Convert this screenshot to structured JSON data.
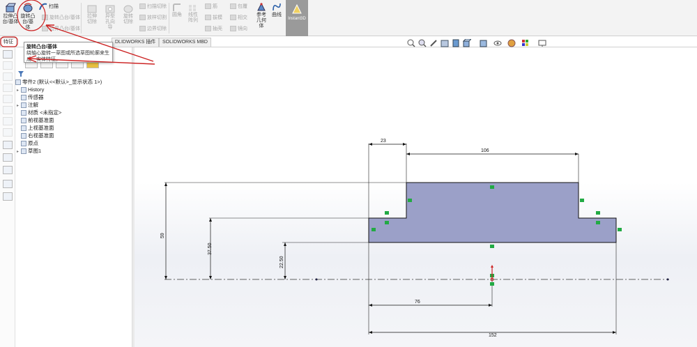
{
  "ribbon": {
    "extrude_boss": "拉伸凸台/基体",
    "revolve_boss": "旋转凸台/基体",
    "sweep": "扫描",
    "loft_disabled": "旋转凸台/基体",
    "boundary_boss": "边界凸台/基体",
    "extrude_cut": "拉伸切除",
    "hole_wizard": "异型孔向导",
    "revolve_cut": "旋转切除",
    "sweep_cut": "扫描切除",
    "loft_cut": "放样切割",
    "boundary_cut": "边界切除",
    "fillet": "圆角",
    "linear_pattern": "线性阵列",
    "rib": "筋",
    "draft": "拔模",
    "shell": "抽壳",
    "wrap": "包覆",
    "intersect": "相交",
    "mirror": "镜向",
    "ref_geometry": "参考几何体",
    "curves": "曲线",
    "instant3d": "Instant3D"
  },
  "tabs": {
    "features": "特征",
    "sw_addins": "SOLIDWORKS 插件",
    "sw_mbd": "SOLIDWORKS MBD",
    "partial_tab": "DLIDWORKS 插件"
  },
  "tooltip": {
    "title": "旋转凸台/基体",
    "desc": "绕轴心旋转一草图或所选草图轮廓来生成一实体特征。"
  },
  "tree": {
    "root": "零件2 (默认<<默认>_显示状态 1>)",
    "items": [
      {
        "label": "History",
        "expand": true
      },
      {
        "label": "传感器",
        "expand": false
      },
      {
        "label": "注解",
        "expand": true
      },
      {
        "label": "材质 <未指定>",
        "expand": false
      },
      {
        "label": "前视基准面",
        "expand": false
      },
      {
        "label": "上视基准面",
        "expand": false
      },
      {
        "label": "右视基准面",
        "expand": false
      },
      {
        "label": "原点",
        "expand": false
      },
      {
        "label": "草图1",
        "expand": true
      }
    ]
  },
  "dimensions": {
    "d23": "23",
    "d106": "106",
    "d59": "59",
    "d3750": "37.50",
    "d2250": "22.50",
    "d76": "76",
    "d152": "152"
  },
  "colors": {
    "profile_fill": "#9ba0c8",
    "annotation_red": "#cc2222",
    "relation_green": "#22aa44"
  }
}
